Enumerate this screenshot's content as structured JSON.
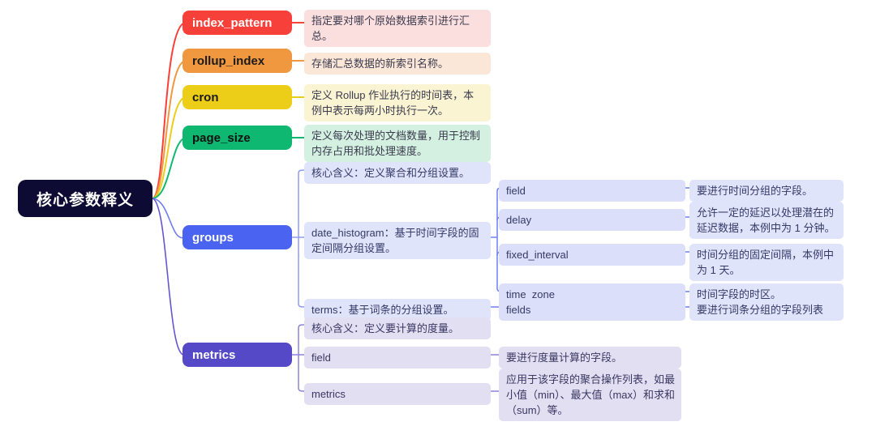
{
  "diagram": {
    "type": "mindmap",
    "title": "核心参数释义",
    "root": {
      "label": "核心参数释义",
      "color": "#0d0b33"
    },
    "branches": [
      {
        "id": "index_pattern",
        "label": "index_pattern",
        "color": "#f8403a",
        "desc": "指定要对哪个原始数据索引进行汇总。"
      },
      {
        "id": "rollup_index",
        "label": "rollup_index",
        "color": "#f0983f",
        "desc": "存储汇总数据的新索引名称。"
      },
      {
        "id": "cron",
        "label": "cron",
        "color": "#eccd18",
        "desc": "定义 Rollup 作业执行的时间表，本例中表示每两小时执行一次。"
      },
      {
        "id": "page_size",
        "label": "page_size",
        "color": "#0fb871",
        "desc": "定义每次处理的文档数量，用于控制内存占用和批处理速度。"
      },
      {
        "id": "groups",
        "label": "groups",
        "color": "#4a63f0",
        "children": [
          {
            "label": "核心含义：定义聚合和分组设置。"
          },
          {
            "label": "date_histogram：基于时间字段的固定间隔分组设置。",
            "children": [
              {
                "label": "field",
                "desc": "要进行时间分组的字段。"
              },
              {
                "label": "delay",
                "desc": "允许一定的延迟以处理潜在的延迟数据，本例中为 1 分钟。"
              },
              {
                "label": "fixed_interval",
                "desc": "时间分组的固定间隔，本例中为 1 天。"
              },
              {
                "label": "time_zone",
                "desc": "时间字段的时区。"
              }
            ]
          },
          {
            "label": "terms：基于词条的分组设置。",
            "children": [
              {
                "label": "fields",
                "desc": "要进行词条分组的字段列表"
              }
            ]
          }
        ]
      },
      {
        "id": "metrics",
        "label": "metrics",
        "color": "#5549c8",
        "children": [
          {
            "label": "核心含义：定义要计算的度量。"
          },
          {
            "label": "field",
            "desc": "要进行度量计算的字段。"
          },
          {
            "label": "metrics",
            "desc": "应用于该字段的聚合操作列表，如最小值（min）、最大值（max）和求和（sum）等。"
          }
        ]
      }
    ]
  }
}
